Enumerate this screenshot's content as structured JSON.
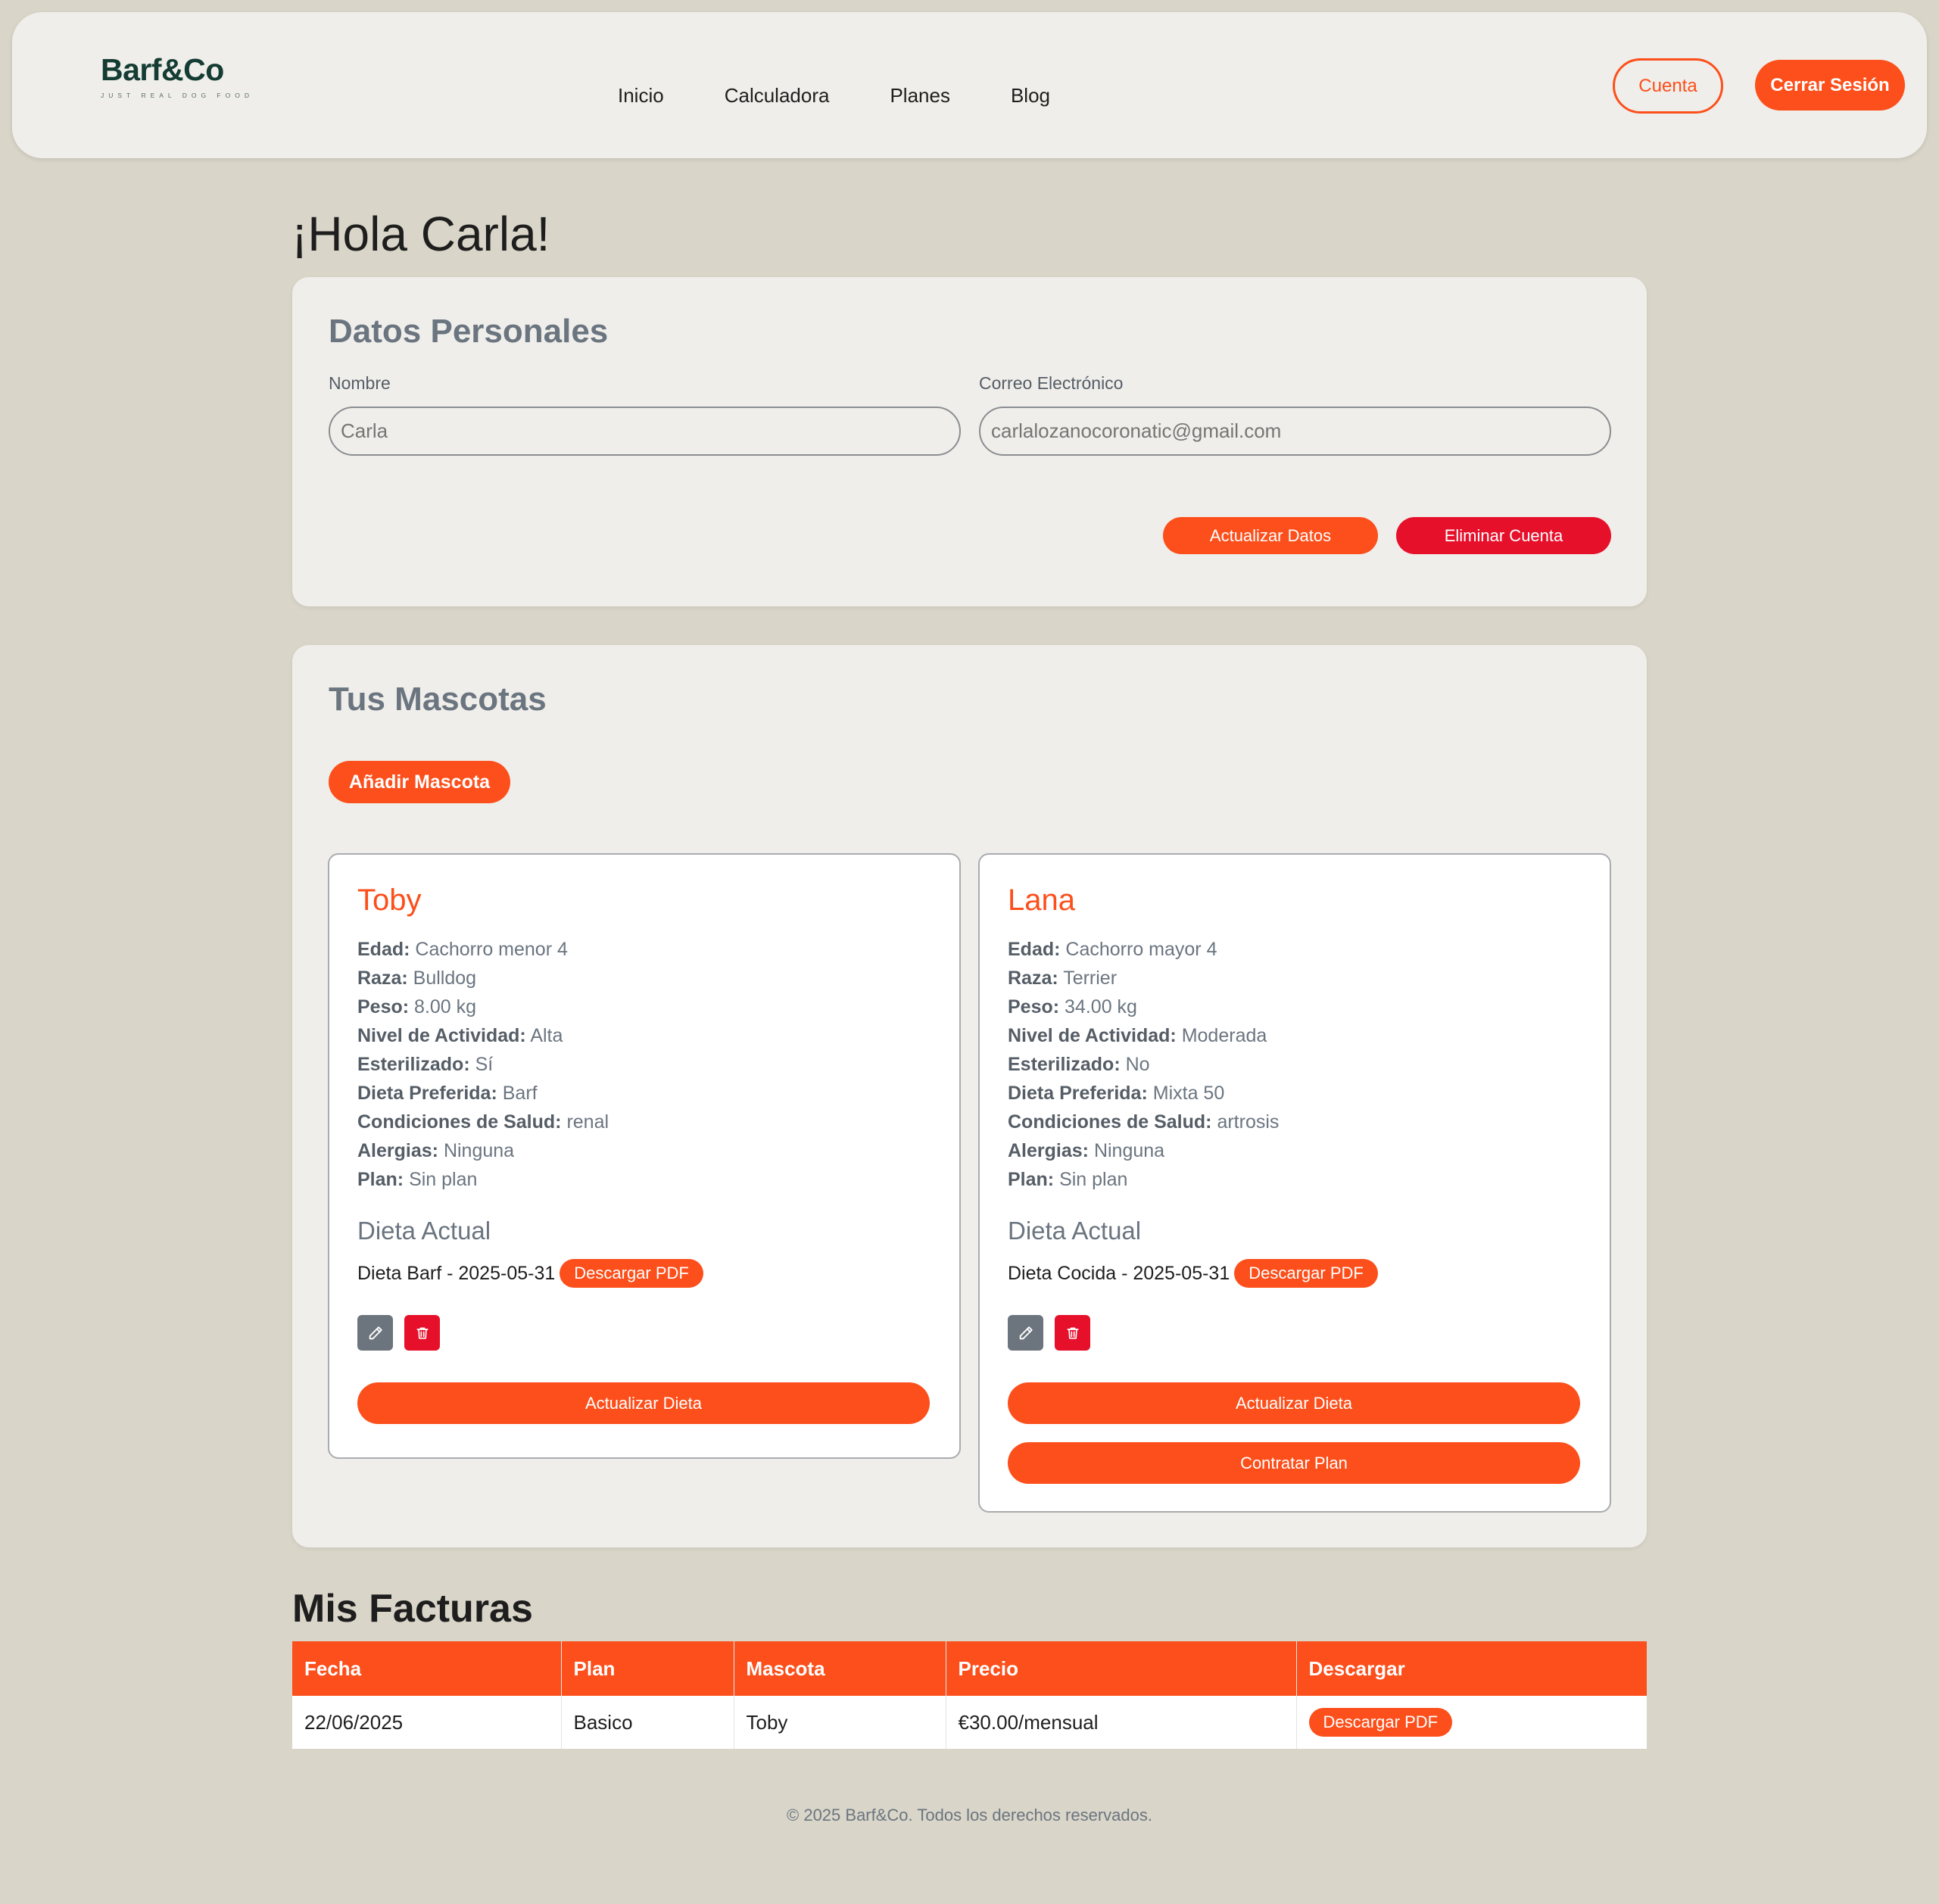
{
  "header": {
    "logo_text": "Barf&Co",
    "logo_tagline": "JUST REAL DOG FOOD",
    "nav": [
      "Inicio",
      "Calculadora",
      "Planes",
      "Blog"
    ],
    "account_label": "Cuenta",
    "logout_label": "Cerrar Sesión"
  },
  "greeting": "¡Hola Carla!",
  "personal": {
    "title": "Datos Personales",
    "name_label": "Nombre",
    "name_placeholder": "Carla",
    "email_label": "Correo Electrónico",
    "email_placeholder": "carlalozanocoronatic@gmail.com",
    "update_label": "Actualizar Datos",
    "delete_label": "Eliminar Cuenta"
  },
  "pets_section": {
    "title": "Tus Mascotas",
    "add_label": "Añadir Mascota",
    "diet_title": "Dieta Actual",
    "pdf_label": "Descargar PDF",
    "update_diet_label": "Actualizar Dieta",
    "plan_label": "Contratar Plan",
    "field_labels": {
      "edad": "Edad:",
      "raza": "Raza:",
      "peso": "Peso:",
      "actividad": "Nivel de Actividad:",
      "esterilizado": "Esterilizado:",
      "dieta": "Dieta Preferida:",
      "condiciones": "Condiciones de Salud:",
      "alergias": "Alergias:",
      "plan": "Plan:"
    },
    "pets": [
      {
        "name": "Toby",
        "edad": "Cachorro menor 4",
        "raza": "Bulldog",
        "peso": "8.00 kg",
        "actividad": "Alta",
        "esterilizado": "Sí",
        "dieta": "Barf",
        "condiciones": "renal",
        "alergias": "Ninguna",
        "plan": "Sin plan",
        "diet_current": "Dieta Barf - 2025-05-31"
      },
      {
        "name": "Lana",
        "edad": "Cachorro mayor 4",
        "raza": "Terrier",
        "peso": "34.00 kg",
        "actividad": "Moderada",
        "esterilizado": "No",
        "dieta": "Mixta 50",
        "condiciones": "artrosis",
        "alergias": "Ninguna",
        "plan": "Sin plan",
        "diet_current": "Dieta Cocida - 2025-05-31"
      }
    ]
  },
  "invoices": {
    "title": "Mis Facturas",
    "columns": [
      "Fecha",
      "Plan",
      "Mascota",
      "Precio",
      "Descargar"
    ],
    "rows": [
      {
        "fecha": "22/06/2025",
        "plan": "Basico",
        "mascota": "Toby",
        "precio": "€30.00/mensual",
        "download_label": "Descargar PDF"
      }
    ]
  },
  "footer": "© 2025 Barf&Co. Todos los derechos reservados.",
  "colors": {
    "accent": "#fc4f1b",
    "danger": "#e6102b",
    "background": "#d9d5c8",
    "card": "#efeeea",
    "brand": "#143c33"
  },
  "icons": [
    "pencil-icon",
    "trash-icon"
  ]
}
